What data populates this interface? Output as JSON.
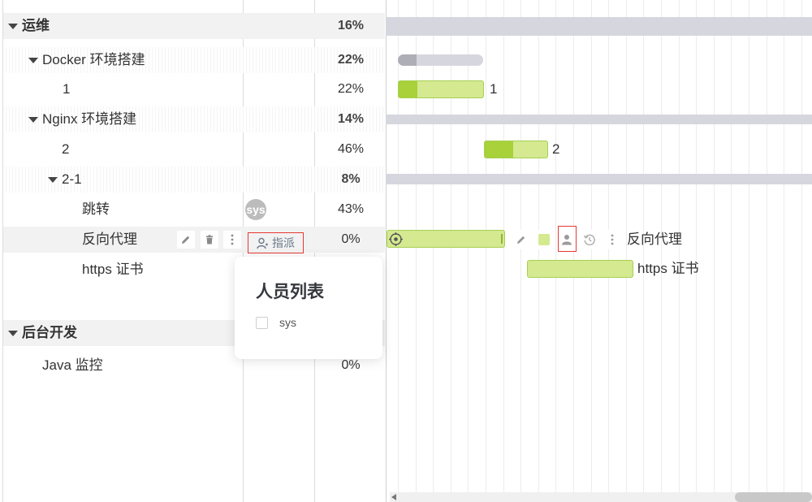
{
  "table": {
    "rows": [
      {
        "name": "运维",
        "percent": "16%"
      },
      {
        "name": "Docker 环境搭建",
        "percent": "22%"
      },
      {
        "name": "1",
        "percent": "22%"
      },
      {
        "name": "Nginx 环境搭建",
        "percent": "14%"
      },
      {
        "name": "2",
        "percent": "46%"
      },
      {
        "name": "2-1",
        "percent": "8%"
      },
      {
        "name": "跳转",
        "percent": "43%",
        "assignee": "sys"
      },
      {
        "name": "反向代理",
        "percent": "0%",
        "assign_label": "指派"
      },
      {
        "name": "https 证书",
        "percent": ""
      },
      {
        "name": "后台开发",
        "percent": ""
      },
      {
        "name": "Java 监控",
        "percent": "0%"
      }
    ]
  },
  "gantt": {
    "labels": {
      "task_1": "1",
      "task_2": "2",
      "reverse_proxy": "反向代理",
      "https_cert": "https 证书"
    },
    "progress": {
      "docker": 0.22,
      "task_1": 0.22,
      "task_2": 0.46,
      "reverse_proxy": 0.0
    }
  },
  "popup": {
    "title": "人员列表",
    "options": [
      {
        "label": "sys",
        "checked": false
      }
    ]
  },
  "colors": {
    "bar_fill": "#d4e990",
    "bar_progress": "#a8d13a",
    "summary_bar": "#d6d6df",
    "highlight_border": "#e53935"
  },
  "icons": [
    "caret-down-icon",
    "pencil-icon",
    "trash-icon",
    "more-vertical-icon",
    "user-assign-icon",
    "target-icon",
    "color-swatch-icon",
    "person-icon",
    "history-icon"
  ]
}
